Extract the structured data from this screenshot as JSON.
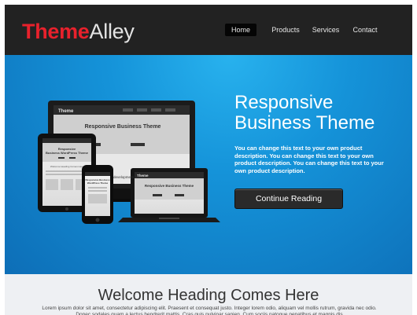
{
  "brand": {
    "logo_part1": "Theme",
    "logo_part2": "Alley",
    "accent": "#e8212c"
  },
  "nav": {
    "items": [
      {
        "label": "Home",
        "active": true
      },
      {
        "label": "Products",
        "active": false
      },
      {
        "label": "Services",
        "active": false
      },
      {
        "label": "Contact",
        "active": false
      }
    ]
  },
  "hero": {
    "title_line1": "Responsive",
    "title_line2": "Business Theme",
    "text": "You can change this text to your own product description. You can change this text to your own product description. You can change this text to your own product description.",
    "cta_label": "Continue Reading",
    "background": "#1593d9"
  },
  "mockup": {
    "monitor_logo": "Theme",
    "monitor_heading": "Responsive Business Theme",
    "laptop_logo": "Theme",
    "laptop_heading": "Responsive Business Theme",
    "tablet_heading_line1": "Responsive",
    "tablet_heading_line2": "Business WordPress Theme",
    "tablet_subheading": "Welcome Heading Comes Here",
    "phone_heading_line1": "Responsive Business",
    "phone_heading_line2": "WordPress Theme",
    "partial_word": "development"
  },
  "welcome": {
    "title": "Welcome Heading Comes Here",
    "text": "Lorem ipsum dolor sit amet, consectetur adipiscing elit. Praesent et consequat justo. Integer lorem odio, aliquam vel mollis rutrum, gravida nec odio. Donec sodales quam a lectus hendrerit mattis. Cras quis pulvinar sapien. Cum sociis natoque penatibus et magnis dis"
  }
}
